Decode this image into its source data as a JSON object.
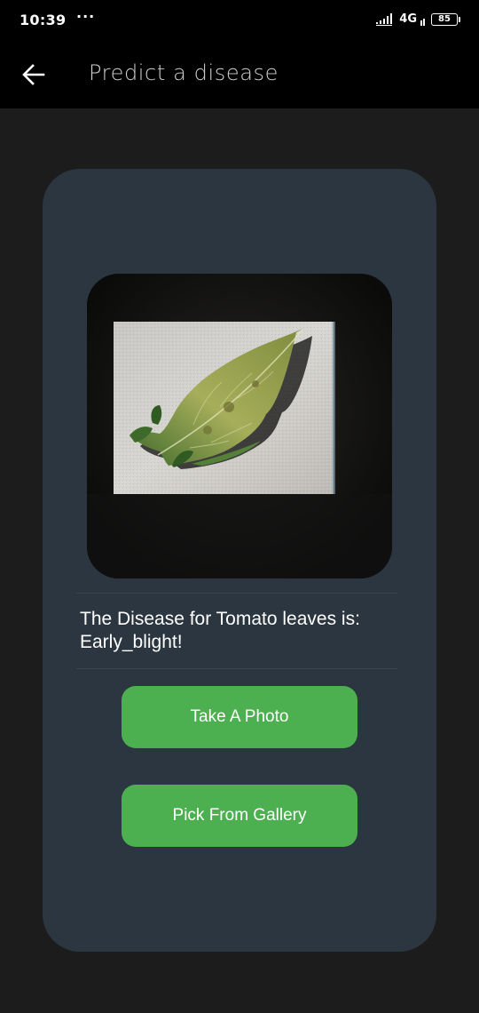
{
  "status_bar": {
    "time": "10:39",
    "dots": "···",
    "network": "4G",
    "battery": "85"
  },
  "app_bar": {
    "title": "Predict a disease",
    "back_icon": "arrow-left-icon"
  },
  "card": {
    "image_alt": "tomato-leaf-photo",
    "result_text": "The Disease for Tomato leaves is: Early_blight!",
    "take_photo_label": "Take A Photo",
    "pick_gallery_label": "Pick From Gallery"
  },
  "colors": {
    "background": "#1c1c1c",
    "app_bar": "#000000",
    "card": "#2b3640",
    "button": "#4caf50",
    "text": "#ffffff"
  }
}
